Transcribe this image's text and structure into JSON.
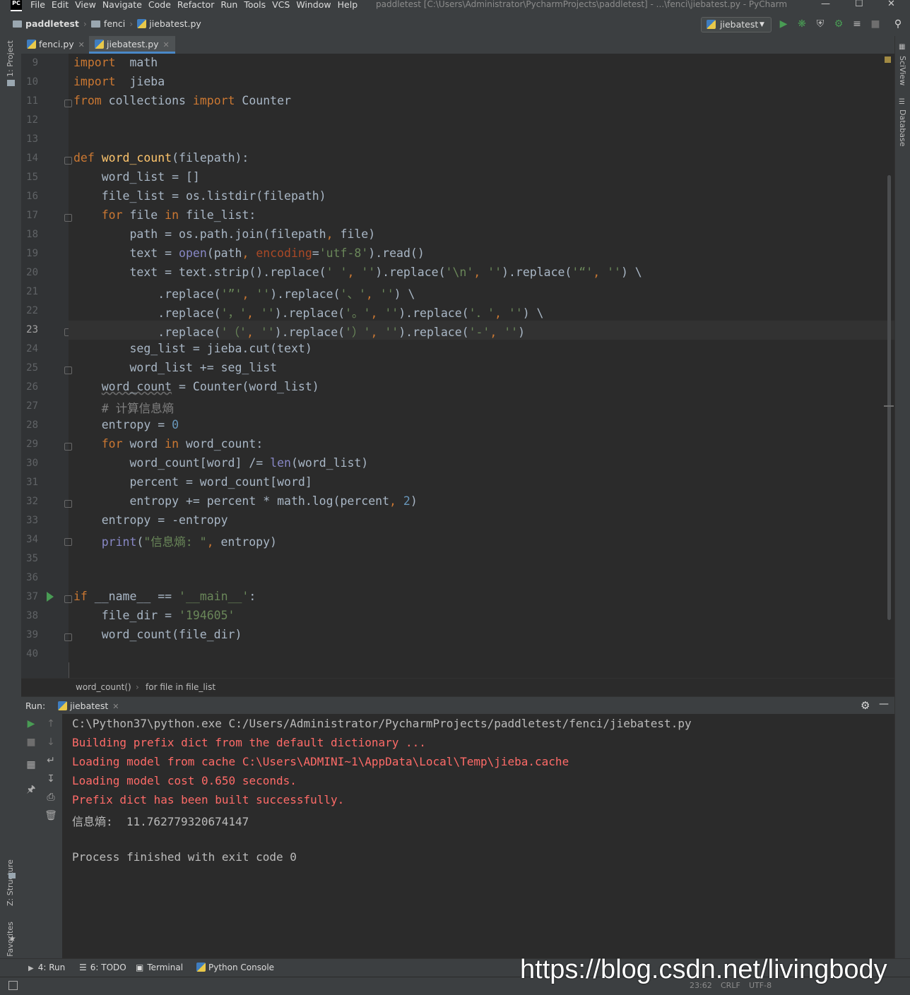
{
  "menubar": {
    "logo": "PC",
    "items": [
      "File",
      "Edit",
      "View",
      "Navigate",
      "Code",
      "Refactor",
      "Run",
      "Tools",
      "VCS",
      "Window",
      "Help"
    ],
    "title": "paddletest [C:\\Users\\Administrator\\PycharmProjects\\paddletest] - ...\\fenci\\jiebatest.py - PyCharm"
  },
  "navbar": {
    "crumbs": [
      "paddletest",
      "fenci",
      "jiebatest.py"
    ],
    "run_config": "jiebatest"
  },
  "sidebar_left": {
    "project": "1: Project",
    "structure": "Z: Structure",
    "favorites": "2: Favorites"
  },
  "sidebar_right": {
    "sciview": "SciView",
    "database": "Database"
  },
  "tabs": [
    {
      "label": "fenci.py",
      "active": false
    },
    {
      "label": "jiebatest.py",
      "active": true
    }
  ],
  "editor": {
    "current_line": 23,
    "lines": [
      {
        "n": "9"
      },
      {
        "n": "10"
      },
      {
        "n": "11"
      },
      {
        "n": "12"
      },
      {
        "n": "13"
      },
      {
        "n": "14"
      },
      {
        "n": "15"
      },
      {
        "n": "16"
      },
      {
        "n": "17"
      },
      {
        "n": "18"
      },
      {
        "n": "19"
      },
      {
        "n": "20"
      },
      {
        "n": "21"
      },
      {
        "n": "22"
      },
      {
        "n": "23"
      },
      {
        "n": "24"
      },
      {
        "n": "25"
      },
      {
        "n": "26"
      },
      {
        "n": "27"
      },
      {
        "n": "28"
      },
      {
        "n": "29"
      },
      {
        "n": "30"
      },
      {
        "n": "31"
      },
      {
        "n": "32"
      },
      {
        "n": "33"
      },
      {
        "n": "34"
      },
      {
        "n": "35"
      },
      {
        "n": "36"
      },
      {
        "n": "37"
      },
      {
        "n": "38"
      },
      {
        "n": "39"
      },
      {
        "n": "40"
      }
    ],
    "code": [
      [
        [
          "kw",
          "import"
        ],
        [
          "",
          "  math"
        ]
      ],
      [
        [
          "kw",
          "import"
        ],
        [
          "",
          "  jieba"
        ]
      ],
      [
        [
          "kw",
          "from"
        ],
        [
          "",
          " collections "
        ],
        [
          "kw",
          "import"
        ],
        [
          "",
          " Counter"
        ]
      ],
      [],
      [],
      [
        [
          "kw",
          "def"
        ],
        [
          "",
          " "
        ],
        [
          "fn",
          "word_count"
        ],
        [
          "",
          "(filepath):"
        ]
      ],
      [
        [
          "",
          "    word_list = []"
        ]
      ],
      [
        [
          "",
          "    file_list = os.listdir(filepath)"
        ]
      ],
      [
        [
          "",
          "    "
        ],
        [
          "kw",
          "for"
        ],
        [
          "",
          " file "
        ],
        [
          "kw",
          "in"
        ],
        [
          "",
          " file_list:"
        ]
      ],
      [
        [
          "",
          "        path = os.path.join(filepath"
        ],
        [
          "kw",
          ","
        ],
        [
          "",
          " file)"
        ]
      ],
      [
        [
          "",
          "        text = "
        ],
        [
          "bi",
          "open"
        ],
        [
          "",
          "(path"
        ],
        [
          "kw",
          ","
        ],
        [
          "",
          " "
        ],
        [
          "kwarg",
          "encoding"
        ],
        [
          "",
          "="
        ],
        [
          "str",
          "'utf-8'"
        ],
        [
          "",
          ").read()"
        ]
      ],
      [
        [
          "",
          "        text = text.strip().replace("
        ],
        [
          "str",
          "' '"
        ],
        [
          "kw",
          ","
        ],
        [
          "",
          " "
        ],
        [
          "str",
          "''"
        ],
        [
          "",
          ").replace("
        ],
        [
          "str",
          "'\\n'"
        ],
        [
          "kw",
          ","
        ],
        [
          "",
          " "
        ],
        [
          "str",
          "''"
        ],
        [
          "",
          ").replace("
        ],
        [
          "str",
          "'“'"
        ],
        [
          "kw",
          ","
        ],
        [
          "",
          " "
        ],
        [
          "str",
          "''"
        ],
        [
          "",
          ") \\"
        ]
      ],
      [
        [
          "",
          "            .replace("
        ],
        [
          "str",
          "'”'"
        ],
        [
          "kw",
          ","
        ],
        [
          "",
          " "
        ],
        [
          "str",
          "''"
        ],
        [
          "",
          ").replace("
        ],
        [
          "str",
          "'、'"
        ],
        [
          "kw",
          ","
        ],
        [
          "",
          " "
        ],
        [
          "str",
          "''"
        ],
        [
          "",
          ") \\"
        ]
      ],
      [
        [
          "",
          "            .replace("
        ],
        [
          "str",
          "'，'"
        ],
        [
          "kw",
          ","
        ],
        [
          "",
          " "
        ],
        [
          "str",
          "''"
        ],
        [
          "",
          ").replace("
        ],
        [
          "str",
          "'。'"
        ],
        [
          "kw",
          ","
        ],
        [
          "",
          " "
        ],
        [
          "str",
          "''"
        ],
        [
          "",
          ").replace("
        ],
        [
          "str",
          "'．'"
        ],
        [
          "kw",
          ","
        ],
        [
          "",
          " "
        ],
        [
          "str",
          "''"
        ],
        [
          "",
          ") \\"
        ]
      ],
      [
        [
          "",
          "            .replace("
        ],
        [
          "str",
          "'（'"
        ],
        [
          "kw",
          ","
        ],
        [
          "",
          " "
        ],
        [
          "str",
          "''"
        ],
        [
          "",
          ").replace("
        ],
        [
          "str",
          "'）'"
        ],
        [
          "kw",
          ","
        ],
        [
          "",
          " "
        ],
        [
          "str",
          "''"
        ],
        [
          "",
          ").replace("
        ],
        [
          "str",
          "'-'"
        ],
        [
          "kw",
          ","
        ],
        [
          "",
          " "
        ],
        [
          "str",
          "''"
        ],
        [
          "",
          ")"
        ]
      ],
      [
        [
          "",
          "        seg_list = jieba.cut(text)"
        ]
      ],
      [
        [
          "",
          "        word_list += seg_list"
        ]
      ],
      [
        [
          "",
          "    "
        ],
        [
          "wavy",
          "word_count"
        ],
        [
          "",
          " = Counter(word_list)"
        ]
      ],
      [
        [
          "",
          "    "
        ],
        [
          "cm",
          "# 计算信息熵"
        ]
      ],
      [
        [
          "",
          "    entropy = "
        ],
        [
          "num",
          "0"
        ]
      ],
      [
        [
          "",
          "    "
        ],
        [
          "kw",
          "for"
        ],
        [
          "",
          " word "
        ],
        [
          "kw",
          "in"
        ],
        [
          "",
          " word_count:"
        ]
      ],
      [
        [
          "",
          "        word_count[word] /= "
        ],
        [
          "bi",
          "len"
        ],
        [
          "",
          "(word_list)"
        ]
      ],
      [
        [
          "",
          "        percent = word_count[word]"
        ]
      ],
      [
        [
          "",
          "        entropy += percent * math.log(percent"
        ],
        [
          "kw",
          ","
        ],
        [
          "",
          " "
        ],
        [
          "num",
          "2"
        ],
        [
          "",
          ")"
        ]
      ],
      [
        [
          "",
          "    entropy = -entropy"
        ]
      ],
      [
        [
          "",
          "    "
        ],
        [
          "bi",
          "print"
        ],
        [
          "",
          "("
        ],
        [
          "str",
          "\"信息熵: \""
        ],
        [
          "kw",
          ","
        ],
        [
          "",
          " entropy)"
        ]
      ],
      [],
      [],
      [
        [
          "kw",
          "if"
        ],
        [
          "",
          " __name__ == "
        ],
        [
          "str",
          "'__main__'"
        ],
        [
          "",
          ":"
        ]
      ],
      [
        [
          "",
          "    file_dir = "
        ],
        [
          "str",
          "'194605'"
        ]
      ],
      [
        [
          "",
          "    word_count(file_dir)"
        ]
      ],
      []
    ]
  },
  "breadcrumb": {
    "items": [
      "word_count()",
      "for file in file_list"
    ]
  },
  "run_panel": {
    "label": "Run:",
    "tab": "jiebatest",
    "output": [
      {
        "text": "C:\\Python37\\python.exe C:/Users/Administrator/PycharmProjects/paddletest/fenci/jiebatest.py",
        "color": "#bbbbbb"
      },
      {
        "text": "Building prefix dict from the default dictionary ...",
        "color": "#ff6b68"
      },
      {
        "text": "Loading model from cache C:\\Users\\ADMINI~1\\AppData\\Local\\Temp\\jieba.cache",
        "color": "#ff6b68"
      },
      {
        "text": "Loading model cost 0.650 seconds.",
        "color": "#ff6b68"
      },
      {
        "text": "Prefix dict has been built successfully.",
        "color": "#ff6b68"
      },
      {
        "text": "信息熵:  11.762779320674147",
        "color": "#bbbbbb"
      },
      {
        "text": "",
        "color": "#bbbbbb"
      },
      {
        "text": "Process finished with exit code 0",
        "color": "#bbbbbb"
      }
    ]
  },
  "bottom_tabs": {
    "run": "4: Run",
    "todo": "6: TODO",
    "terminal": "Terminal",
    "python_console": "Python Console"
  },
  "status": {
    "position": "23:62",
    "line_sep": "CRLF",
    "encoding": "UTF-8"
  },
  "watermark": "https://blog.csdn.net/livingbody",
  "colors": {
    "accent": "#4a88c7",
    "run_green": "#499c54",
    "error_red": "#ff6b68"
  }
}
